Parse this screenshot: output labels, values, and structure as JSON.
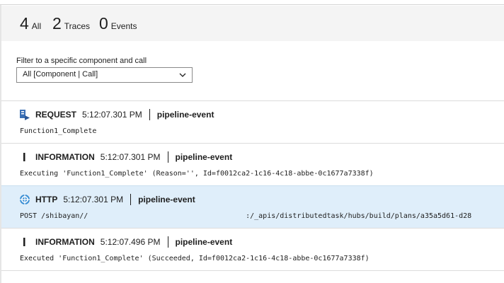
{
  "counts": [
    {
      "value": "4",
      "label": "All"
    },
    {
      "value": "2",
      "label": "Traces"
    },
    {
      "value": "0",
      "label": "Events"
    }
  ],
  "filter": {
    "label": "Filter to a specific component and call",
    "selected": "All [Component | Call]"
  },
  "rows": [
    {
      "icon": "request-icon",
      "type": "REQUEST",
      "time": "5:12:07.301 PM",
      "source": "pipeline-event",
      "message": "Function1_Complete"
    },
    {
      "icon": "information-icon",
      "type": "INFORMATION",
      "time": "5:12:07.301 PM",
      "source": "pipeline-event",
      "message": "Executing 'Function1_Complete' (Reason='', Id=f0012ca2-1c16-4c18-abbe-0c1677a7338f)"
    },
    {
      "icon": "http-dependency-icon",
      "type": "HTTP",
      "time": "5:12:07.301 PM",
      "source": "pipeline-event",
      "message": "POST /shibayan//                                     :/_apis/distributedtask/hubs/build/plans/a35a5d61-d28"
    },
    {
      "icon": "information-icon",
      "type": "INFORMATION",
      "time": "5:12:07.496 PM",
      "source": "pipeline-event",
      "message": "Executed 'Function1_Complete' (Succeeded, Id=f0012ca2-1c16-4c18-abbe-0c1677a7338f)"
    }
  ],
  "colors": {
    "counts_background": "#f4f4f4",
    "selected_row": "#dfeefa",
    "request_icon": "#3a6fb5",
    "http_icon": "#3b8fd4"
  }
}
